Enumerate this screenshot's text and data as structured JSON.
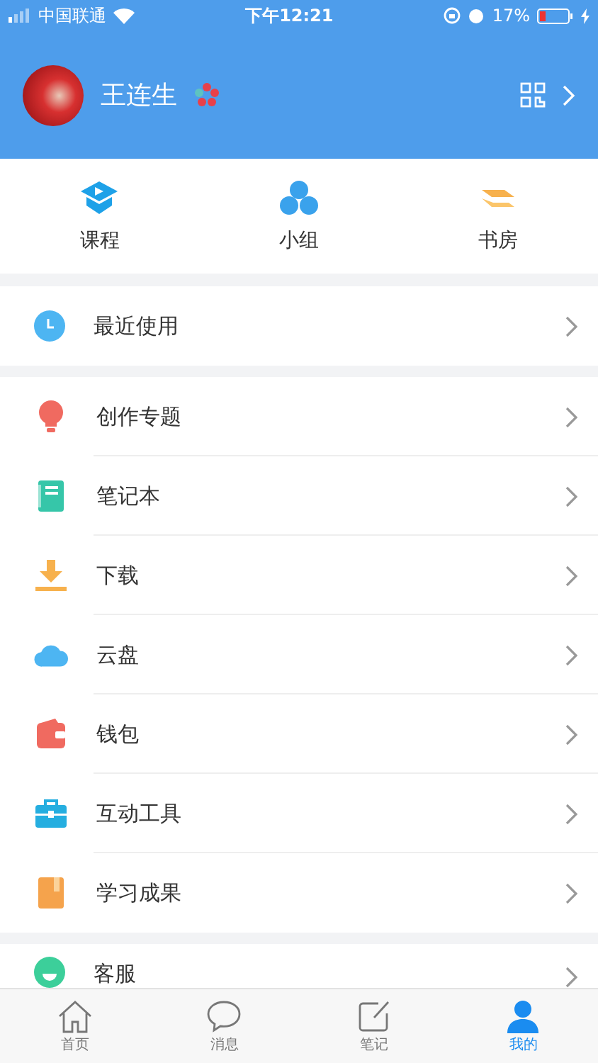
{
  "status_bar": {
    "carrier": "中国联通",
    "time": "下午12:21",
    "battery": "17%"
  },
  "profile": {
    "name": "王连生"
  },
  "shortcuts": [
    {
      "label": "课程"
    },
    {
      "label": "小组"
    },
    {
      "label": "书房"
    }
  ],
  "recent": {
    "label": "最近使用"
  },
  "menu": [
    {
      "label": "创作专题"
    },
    {
      "label": "笔记本"
    },
    {
      "label": "下载"
    },
    {
      "label": "云盘"
    },
    {
      "label": "钱包"
    },
    {
      "label": "互动工具"
    },
    {
      "label": "学习成果"
    }
  ],
  "service": {
    "label": "客服"
  },
  "tab_bar": [
    {
      "label": "首页",
      "selected": false
    },
    {
      "label": "消息",
      "selected": false
    },
    {
      "label": "笔记",
      "selected": false
    },
    {
      "label": "我的",
      "selected": true
    }
  ]
}
